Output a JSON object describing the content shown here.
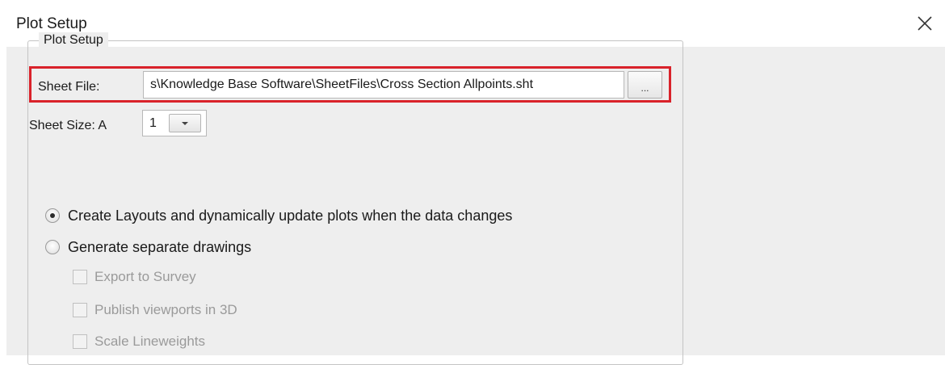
{
  "window": {
    "title": "Plot Setup"
  },
  "group": {
    "label": "Plot Setup"
  },
  "sheet_file": {
    "label": "Sheet File:",
    "value": "s\\Knowledge Base Software\\SheetFiles\\Cross Section Allpoints.sht",
    "browse_label": "..."
  },
  "sheet_size": {
    "label": "Sheet Size: A",
    "value": "1"
  },
  "options": {
    "create_layouts": {
      "label": "Create Layouts and dynamically update plots when the data changes",
      "selected": true
    },
    "generate_drawings": {
      "label": "Generate separate drawings",
      "selected": false
    }
  },
  "checkboxes": {
    "export_survey": "Export to Survey",
    "publish_3d": "Publish viewports in 3D",
    "scale_lineweights": "Scale Lineweights"
  },
  "colors": {
    "highlight": "#d9222a",
    "background": "#eeeeee"
  },
  "icons": {
    "close": "close-icon",
    "dropdown": "chevron-down-icon"
  }
}
